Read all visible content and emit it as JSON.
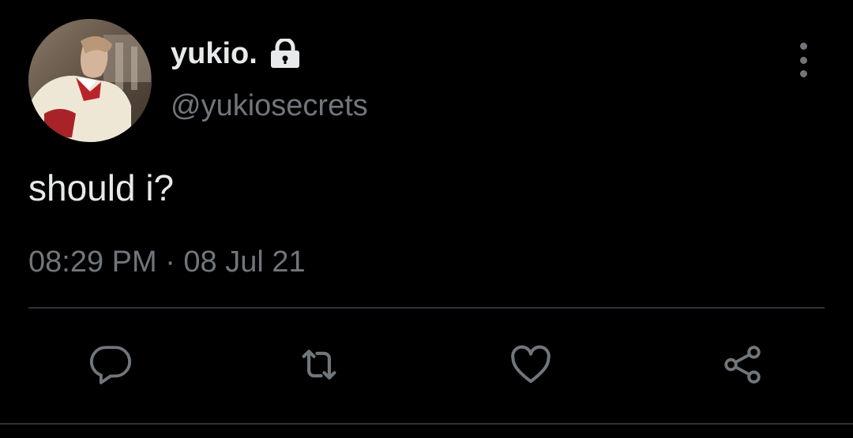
{
  "tweet": {
    "author": {
      "display_name": "yukio.",
      "handle": "@yukiosecrets",
      "protected": true
    },
    "text": "should i?",
    "timestamp": "08:29 PM · 08 Jul 21"
  },
  "actions": [
    {
      "name": "reply",
      "icon": "reply-icon"
    },
    {
      "name": "retweet",
      "icon": "retweet-icon"
    },
    {
      "name": "like",
      "icon": "heart-icon"
    },
    {
      "name": "share",
      "icon": "share-icon"
    }
  ],
  "colors": {
    "background": "#000000",
    "primary_text": "#e7e9ea",
    "secondary_text": "#71767b",
    "divider": "#2f3336"
  }
}
